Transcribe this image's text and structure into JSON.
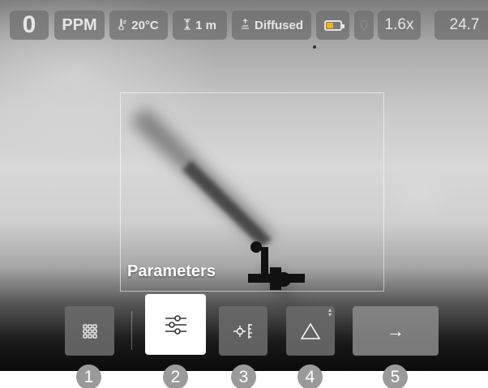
{
  "status_bar": {
    "ppm_value": "0",
    "ppm_unit": "PPM",
    "temperature": "20°C",
    "distance": "1 m",
    "lighting": "Diffused",
    "battery_color": "#f2b705",
    "zoom": "1.6x",
    "fps": "24.7",
    "icons": {
      "temperature": "thermometer-icon",
      "distance": "distance-icon",
      "lighting": "lighting-icon",
      "battery": "battery-icon",
      "gps": "gps-icon"
    }
  },
  "panel": {
    "title": "Parameters"
  },
  "toolbar": {
    "buttons": [
      {
        "icon": "grid-icon"
      },
      {
        "icon": "sliders-icon",
        "selected": true
      },
      {
        "icon": "target-icon"
      },
      {
        "icon": "triangle-icon"
      },
      {
        "icon": "arrow-right-icon",
        "glyph": "→"
      }
    ]
  },
  "step_badges": [
    "1",
    "2",
    "3",
    "4",
    "5"
  ],
  "colors": {
    "chip_bg": "#6e6e6e",
    "badge_bg": "#9a9a9a",
    "selected_button_bg": "#ffffff"
  }
}
